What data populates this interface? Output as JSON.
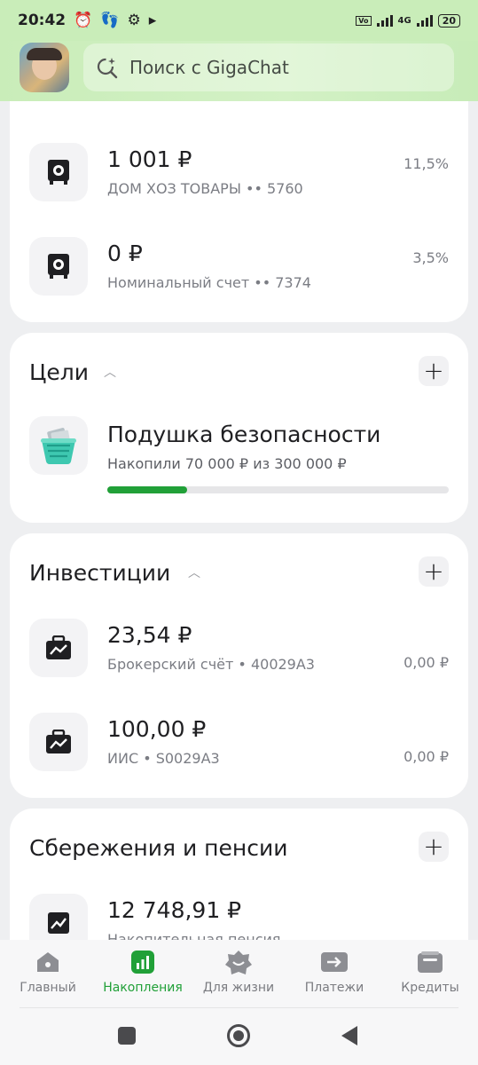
{
  "status_bar": {
    "time": "20:42",
    "network": "4G",
    "battery": "20"
  },
  "header": {
    "search_placeholder": "Поиск с GigaChat"
  },
  "accounts": [
    {
      "amount": "1 001 ₽",
      "name": "ДОМ ХОЗ ТОВАРЫ •• 5760",
      "rate": "11,5%"
    },
    {
      "amount": "0 ₽",
      "name": "Номинальный счет •• 7374",
      "rate": "3,5%"
    }
  ],
  "goals": {
    "title": "Цели",
    "items": [
      {
        "name": "Подушка безопасности",
        "progress_text": "Накопили 70 000 ₽ из 300 000 ₽",
        "progress": 0.2333
      }
    ]
  },
  "investments": {
    "title": "Инвестиции",
    "items": [
      {
        "amount": "23,54 ₽",
        "name": "Брокерский счёт • 40029А3",
        "change": "0,00 ₽"
      },
      {
        "amount": "100,00 ₽",
        "name": "ИИС • S0029А3",
        "change": "0,00 ₽"
      }
    ]
  },
  "savings": {
    "title": "Сбережения и пенсии",
    "items": [
      {
        "amount": "12 748,91 ₽",
        "name": "Накопительная пенсия"
      }
    ]
  },
  "tabbar": {
    "tabs": [
      {
        "label": "Главный"
      },
      {
        "label": "Накопления",
        "active": true
      },
      {
        "label": "Для жизни"
      },
      {
        "label": "Платежи"
      },
      {
        "label": "Кредиты"
      }
    ]
  },
  "colors": {
    "accent": "#21a038",
    "header_bg": "#c9edb9"
  }
}
